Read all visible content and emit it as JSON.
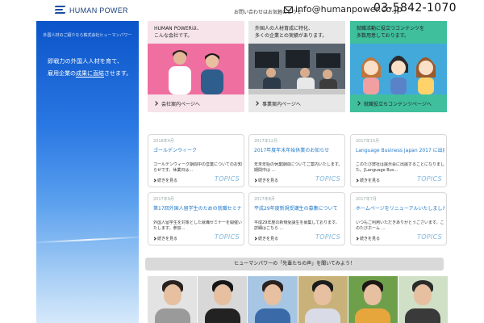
{
  "header": {
    "logo_text": "HUMAN POWER",
    "note": "お問い合わせはお気軽にどうぞ",
    "email": "info@humanpower.co.jp",
    "tel": "03-5842-1070"
  },
  "hero": {
    "top_text": "外国人材のご紹介なら株式会社ヒューマンパワー",
    "line1": "即戦力の外国人人材を育て、",
    "line2_prefix": "雇用企業の",
    "line2_link": "成果に直結",
    "line2_suffix": "させます。"
  },
  "features": [
    {
      "head": "HUMAN POWERは、\nこんな会社です。",
      "foot": "会社案内ページへ",
      "bg": "#f7e3ea",
      "img_bg": "#ef6fa1"
    },
    {
      "head": "外国人の人材育成に特化、\n多くの企業との実績があります。",
      "foot": "事業案内ページへ",
      "bg": "#e8e8e8",
      "img_bg": "#6d7a86"
    },
    {
      "head": "就職活動に役立つコンテンツを\n多数用意しております。",
      "foot": "就職役立ちコンテンツページへ",
      "bg": "#3fbf9c",
      "img_bg": "#43a9db"
    }
  ],
  "news": [
    {
      "date": "2018年4月",
      "title": "ゴールデンウィーク",
      "body": "ゴールデンウィーク期間中の営業についてのお知らせです。休業日は…",
      "more": "続きを見る",
      "tag": "TOPICS"
    },
    {
      "date": "2017年12月",
      "title": "2017年度年末年始休業のお知らせ",
      "body": "年末年始の休業期間についてご案内いたします。期間中は …",
      "more": "続きを見る",
      "tag": "TOPICS"
    },
    {
      "date": "2017年10月",
      "title": "Language Business Japan 2017 に出展します",
      "body": "このたび弊社は展示会に出展することになりました。[Language Bus…",
      "more": "続きを見る",
      "tag": "TOPICS"
    },
    {
      "date": "2017年9月",
      "title": "第17回外国人留学生のための就職セミナー開催",
      "body": "外国人留学生を対象とした就職セミナーを開催いたします。参加…",
      "more": "続きを見る",
      "tag": "TOPICS"
    },
    {
      "date": "2017年8月",
      "title": "平成29年度新規受講生の募集について",
      "body": "平成29年度の新規受講生を募集しております。詳細はこちら …",
      "more": "続きを見る",
      "tag": "TOPICS"
    },
    {
      "date": "2017年7月",
      "title": "ホームページをリニューアルいたしました",
      "body": "いつもご利用いただきありがとうございます。このたびホーム …",
      "more": "続きを見る",
      "tag": "TOPICS"
    }
  ],
  "banner": "ヒューマンパワーの「先輩たちの声」を聞いてみよう！",
  "colors": {
    "accent": "#1a4f9e",
    "link": "#1f78c8",
    "topics": "#7fb7df"
  },
  "people": [
    {
      "bg": "#e3e3e3",
      "body": "#9a9a9a",
      "hair": "#2a2220"
    },
    {
      "bg": "#d8d8d8",
      "body": "#222222",
      "hair": "#161616"
    },
    {
      "bg": "#a7c6e4",
      "body": "#3b6aa8",
      "hair": "#2a2220"
    },
    {
      "bg": "#c8b27a",
      "body": "#d9dbe6",
      "hair": "#1c1c1c"
    },
    {
      "bg": "#6ea04b",
      "body": "#e7a63c",
      "hair": "#1c1714"
    },
    {
      "bg": "#cfe0c6",
      "body": "#3a3a3a",
      "hair": "#2b2b2b"
    }
  ]
}
